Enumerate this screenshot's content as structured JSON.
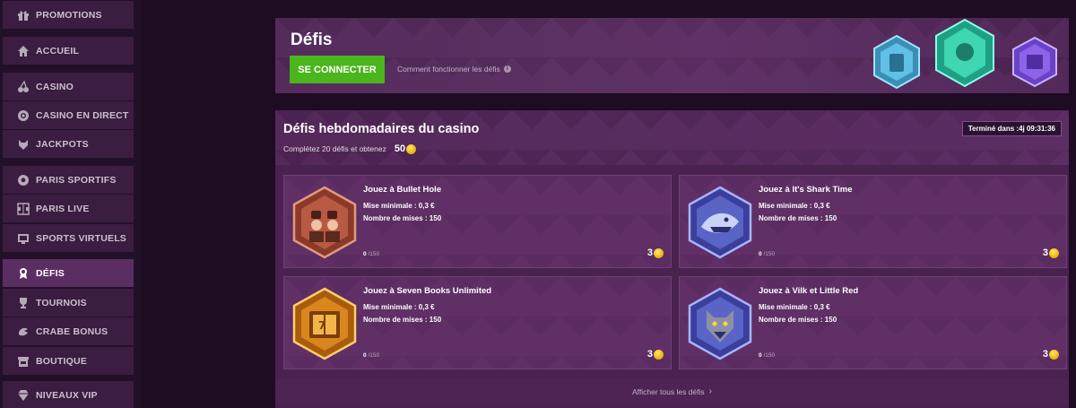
{
  "sidebar": {
    "items": [
      {
        "label": "PROMOTIONS",
        "icon": "gift-icon"
      },
      {
        "label": "ACCUEIL",
        "icon": "home-icon"
      },
      {
        "label": "CASINO",
        "icon": "cherries-icon"
      },
      {
        "label": "CASINO EN DIRECT",
        "icon": "chip-icon"
      },
      {
        "label": "JACKPOTS",
        "icon": "wolf-icon"
      },
      {
        "label": "PARIS SPORTIFS",
        "icon": "football-icon"
      },
      {
        "label": "PARIS LIVE",
        "icon": "live-field-icon"
      },
      {
        "label": "SPORTS VIRTUELS",
        "icon": "virtual-sports-icon"
      },
      {
        "label": "DÉFIS",
        "icon": "award-icon",
        "active": true
      },
      {
        "label": "TOURNOIS",
        "icon": "trophy-icon"
      },
      {
        "label": "CRABE BONUS",
        "icon": "crab-claw-icon"
      },
      {
        "label": "BOUTIQUE",
        "icon": "shop-icon"
      },
      {
        "label": "NIVEAUX VIP",
        "icon": "diamond-icon"
      }
    ]
  },
  "hero": {
    "title": "Défis",
    "connect_label": "SE CONNECTER",
    "how_link": "Comment fonctionner les défis"
  },
  "weekly": {
    "title": "Défis hebdomadaires du casino",
    "subtitle": "Complétez 20 défis et obtenez",
    "reward": "50",
    "timer": "Terminé dans :4j 09:31:36",
    "show_all": "Afficher tous les défis"
  },
  "cards": [
    {
      "title": "Jouez à Bullet Hole",
      "min_bet": "Mise minimale : 0,3 €",
      "bets": "Nombre de mises : 150",
      "progress_done": "0",
      "progress_total": "/150",
      "reward": "3",
      "icon": "outlaws-game-icon"
    },
    {
      "title": "Jouez à It's Shark Time",
      "min_bet": "Mise minimale : 0,3 €",
      "bets": "Nombre de mises : 150",
      "progress_done": "0",
      "progress_total": "/150",
      "reward": "3",
      "icon": "shark-game-icon"
    },
    {
      "title": "Jouez à Seven Books Unlimited",
      "min_bet": "Mise minimale : 0,3 €",
      "bets": "Nombre de mises : 150",
      "progress_done": "0",
      "progress_total": "/150",
      "reward": "3",
      "icon": "book-game-icon"
    },
    {
      "title": "Jouez à Vilk et Little Red",
      "min_bet": "Mise minimale : 0,3 €",
      "bets": "Nombre de mises : 150",
      "progress_done": "0",
      "progress_total": "/150",
      "reward": "3",
      "icon": "wolf-game-icon"
    }
  ],
  "colors": {
    "accent_green": "#4ab51c",
    "active_nav": "#5b2e63",
    "coin": "#f0b60c"
  }
}
